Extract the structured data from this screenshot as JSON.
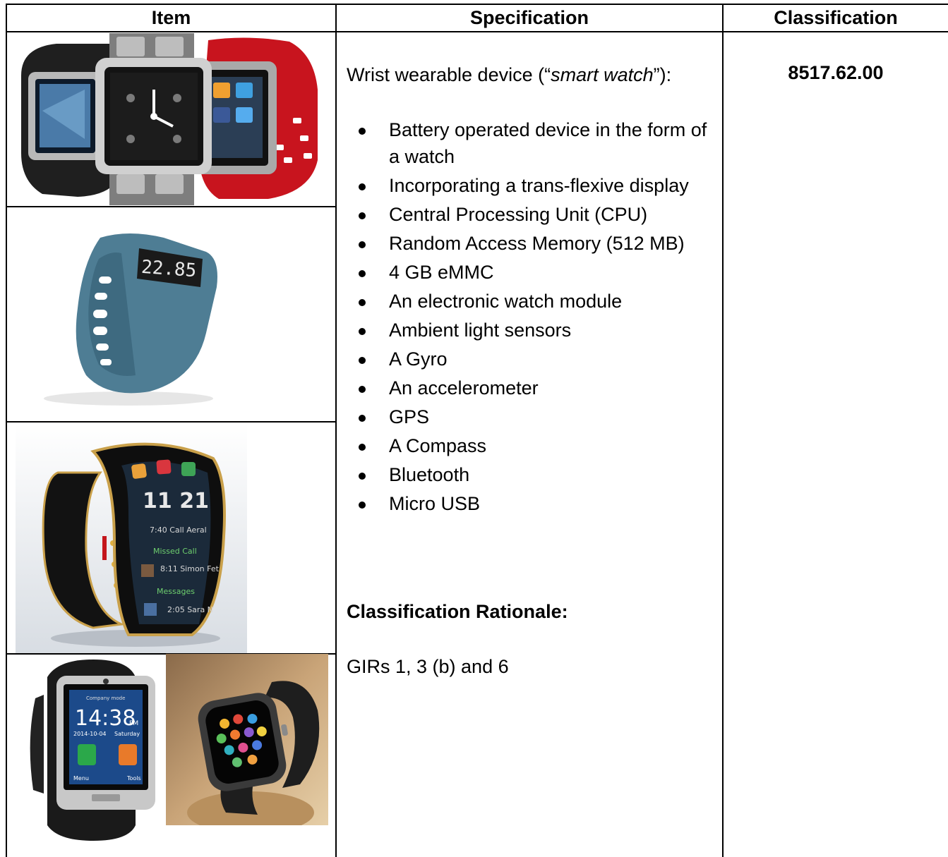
{
  "table": {
    "headers": {
      "item": "Item",
      "specification": "Specification",
      "classification": "Classification"
    },
    "spec_intro_prefix": "Wrist wearable device (“",
    "spec_intro_italic": "smart watch",
    "spec_intro_suffix": "”):",
    "spec_items": [
      "Battery operated device in the form of a watch",
      "Incorporating a trans-flexive display",
      "Central Processing Unit (CPU)",
      "Random Access Memory (512 MB)",
      "4 GB eMMC",
      "An electronic watch module",
      "Ambient light sensors",
      "A Gyro",
      "An accelerometer",
      "GPS",
      "A Compass",
      "Bluetooth",
      "Micro USB"
    ],
    "rationale_heading": "Classification Rationale:",
    "rationale_text": "GIRs 1, 3 (b) and 6",
    "classification_code": "8517.62.00"
  },
  "images": {
    "fitness_band_display": "22.85",
    "curved_watch_time": "11 21",
    "curved_watch_lines": [
      "7:40 Call Aeral",
      "Missed Call",
      "8:11 Simon Fet",
      "Messages",
      "2:05 Sara N"
    ],
    "square_watch_time": "14:38",
    "square_watch_ampm": "PM",
    "square_watch_date": "2014-10-04",
    "square_watch_day": "Saturday",
    "square_watch_top": "Company mode",
    "square_watch_menu": "Menu",
    "square_watch_tools": "Tools"
  },
  "colors": {
    "grid": "#000000",
    "band_blue": "#4e7d94",
    "red_strap": "#c8141e",
    "gold_trim": "#c9a04a"
  }
}
